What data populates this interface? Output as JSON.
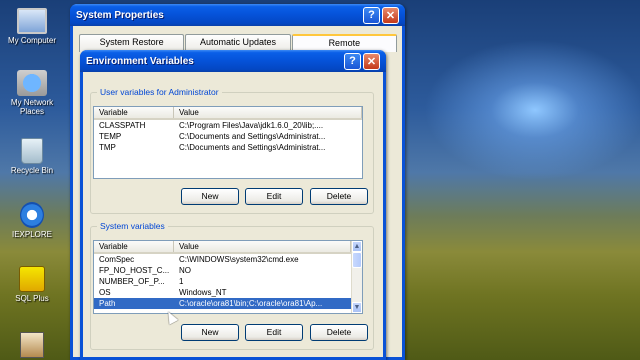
{
  "desktop": {
    "icons": [
      {
        "label": "My Computer"
      },
      {
        "label": "My Network Places"
      },
      {
        "label": "Recycle Bin"
      },
      {
        "label": "IEXPLORE"
      },
      {
        "label": "SQL Plus"
      }
    ]
  },
  "system_properties": {
    "title": "System Properties",
    "help_glyph": "?",
    "close_glyph": "✕",
    "tabs": [
      {
        "label": "System Restore"
      },
      {
        "label": "Automatic Updates"
      },
      {
        "label": "Remote"
      }
    ]
  },
  "env_dialog": {
    "title": "Environment Variables",
    "help_glyph": "?",
    "close_glyph": "✕",
    "user_group_title": "User variables for Administrator",
    "system_group_title": "System variables",
    "columns": {
      "variable": "Variable",
      "value": "Value"
    },
    "user_vars": [
      {
        "name": "CLASSPATH",
        "value": "C:\\Program Files\\Java\\jdk1.6.0_20\\lib;...."
      },
      {
        "name": "TEMP",
        "value": "C:\\Documents and Settings\\Administrat..."
      },
      {
        "name": "TMP",
        "value": "C:\\Documents and Settings\\Administrat..."
      }
    ],
    "system_vars": [
      {
        "name": "ComSpec",
        "value": "C:\\WINDOWS\\system32\\cmd.exe"
      },
      {
        "name": "FP_NO_HOST_C...",
        "value": "NO"
      },
      {
        "name": "NUMBER_OF_P...",
        "value": "1"
      },
      {
        "name": "OS",
        "value": "Windows_NT"
      },
      {
        "name": "Path",
        "value": "C:\\oracle\\ora81\\bin;C:\\oracle\\ora81\\Ap...",
        "selected": true
      }
    ],
    "buttons": {
      "new": "New",
      "edit": "Edit",
      "delete": "Delete"
    },
    "scroll_up_glyph": "▲",
    "scroll_down_glyph": "▼"
  }
}
